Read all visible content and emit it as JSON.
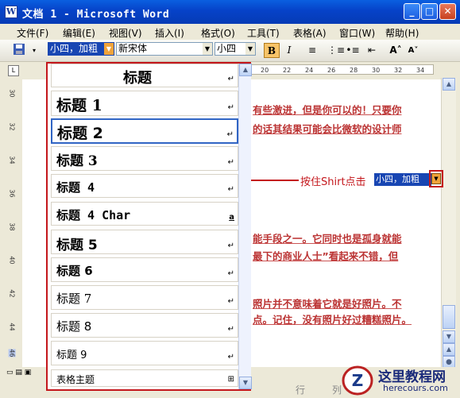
{
  "window": {
    "title": "文档 1 - Microsoft Word",
    "app_icon": "word-document-icon",
    "buttons": [
      "minimize",
      "maximize",
      "close"
    ]
  },
  "menu": {
    "items": [
      {
        "label": "文件(F)"
      },
      {
        "label": "编辑(E)"
      },
      {
        "label": "视图(V)"
      },
      {
        "label": "插入(I)"
      },
      {
        "label": "格式(O)"
      },
      {
        "label": "工具(T)"
      },
      {
        "label": "表格(A)"
      },
      {
        "label": "窗口(W)"
      },
      {
        "label": "帮助(H)"
      }
    ]
  },
  "toolbar": {
    "style_value": "小四，加粗",
    "font_value": "新宋体",
    "size_value": "小四",
    "bold_label": "B",
    "italic_label": "I"
  },
  "ruler": {
    "numbers": [
      "20",
      "22",
      "24",
      "26",
      "28",
      "30",
      "32",
      "34"
    ]
  },
  "vruler": {
    "numbers": [
      "30",
      "32",
      "34",
      "36",
      "38",
      "40",
      "42",
      "44",
      "46"
    ]
  },
  "style_dropdown": {
    "items": [
      {
        "label": "标题",
        "mark": "↵"
      },
      {
        "label": "标题 1",
        "mark": "↵"
      },
      {
        "label": "标题 2",
        "mark": "↵"
      },
      {
        "label": "标题 3",
        "mark": "↵"
      },
      {
        "label": "标题 4",
        "mark": "↵"
      },
      {
        "label": "标题 4 Char",
        "mark": "a"
      },
      {
        "label": "标题 5",
        "mark": "↵"
      },
      {
        "label": "标题 6",
        "mark": "↵"
      },
      {
        "label": "标题 7",
        "mark": "↵"
      },
      {
        "label": "标题 8",
        "mark": "↵"
      },
      {
        "label": "标题 9",
        "mark": "↵"
      },
      {
        "label": "表格主题",
        "mark": "⊞"
      }
    ]
  },
  "document": {
    "lines": [
      "有些激进，但是你可以的！只要你",
      "的话其结果可能会比微软的设计师",
      "能手段之一。它同时也是孤身就能",
      "最下的商业人士”看起来不错，但",
      "照片并不意味着它就是好照片。不",
      "点。记住，没有照片好过糟糕照片。"
    ]
  },
  "annotation": {
    "text": "按住Shirt点击",
    "combo_value": "小四，加粗"
  },
  "status": {
    "items": [
      "行",
      "列"
    ]
  },
  "watermark": {
    "title": "这里教程网",
    "url": "herecours.com"
  }
}
